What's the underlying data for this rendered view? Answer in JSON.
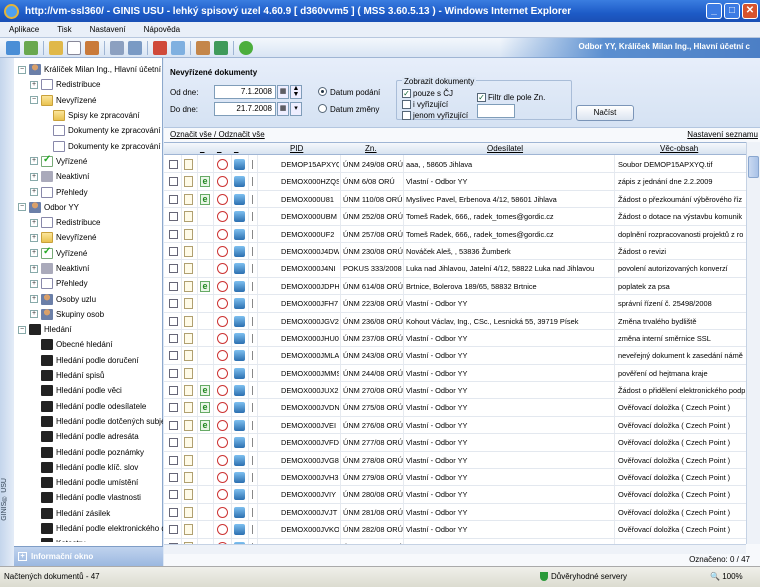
{
  "window": {
    "title": "http://vm-ssl360/ - GINIS USU - lehký spisový uzel 4.60.9 [ d360vvm5 ] ( MSS 3.60.5.13 ) - Windows Internet Explorer"
  },
  "menu": [
    "Aplikace",
    "Tisk",
    "Nastavení",
    "Nápověda"
  ],
  "user": "Odbor YY, Králíček Milan Ing., Hlavní účetní c",
  "tree": [
    {
      "label": "Králíček Milan Ing., Hlavní účetní c",
      "level": 0,
      "pm": "−",
      "icon": "user"
    },
    {
      "label": "Redistribuce",
      "level": 1,
      "pm": "+",
      "icon": "doc"
    },
    {
      "label": "Nevyřízené",
      "level": 1,
      "pm": "−",
      "icon": "folder"
    },
    {
      "label": "Spisy ke zpracování",
      "level": 2,
      "pm": "",
      "icon": "folder"
    },
    {
      "label": "Dokumenty ke zpracování",
      "level": 2,
      "pm": "",
      "icon": "doc"
    },
    {
      "label": "Dokumenty ke zpracování",
      "level": 2,
      "pm": "",
      "icon": "doc"
    },
    {
      "label": "Vyřízené",
      "level": 1,
      "pm": "+",
      "icon": "check"
    },
    {
      "label": "Neaktivní",
      "level": 1,
      "pm": "+",
      "icon": "grey"
    },
    {
      "label": "Přehledy",
      "level": 1,
      "pm": "+",
      "icon": "doc"
    },
    {
      "label": "Odbor YY",
      "level": 0,
      "pm": "−",
      "icon": "user"
    },
    {
      "label": "Redistribuce",
      "level": 1,
      "pm": "+",
      "icon": "doc"
    },
    {
      "label": "Nevyřízené",
      "level": 1,
      "pm": "+",
      "icon": "folder"
    },
    {
      "label": "Vyřízené",
      "level": 1,
      "pm": "+",
      "icon": "check"
    },
    {
      "label": "Neaktivní",
      "level": 1,
      "pm": "+",
      "icon": "grey"
    },
    {
      "label": "Přehledy",
      "level": 1,
      "pm": "+",
      "icon": "doc"
    },
    {
      "label": "Osoby uzlu",
      "level": 1,
      "pm": "+",
      "icon": "user"
    },
    {
      "label": "Skupiny osob",
      "level": 1,
      "pm": "+",
      "icon": "user"
    },
    {
      "label": "Hledání",
      "level": 0,
      "pm": "−",
      "icon": "bino"
    },
    {
      "label": "Obecné hledání",
      "level": 1,
      "pm": "",
      "icon": "bino"
    },
    {
      "label": "Hledání podle doručení",
      "level": 1,
      "pm": "",
      "icon": "bino"
    },
    {
      "label": "Hledání spisů",
      "level": 1,
      "pm": "",
      "icon": "bino"
    },
    {
      "label": "Hledání podle věci",
      "level": 1,
      "pm": "",
      "icon": "bino"
    },
    {
      "label": "Hledání podle odesílatele",
      "level": 1,
      "pm": "",
      "icon": "bino"
    },
    {
      "label": "Hledání podle dotčených subjek",
      "level": 1,
      "pm": "",
      "icon": "bino"
    },
    {
      "label": "Hledání podle adresáta",
      "level": 1,
      "pm": "",
      "icon": "bino"
    },
    {
      "label": "Hledání podle poznámky",
      "level": 1,
      "pm": "",
      "icon": "bino"
    },
    {
      "label": "Hledání podle klíč. slov",
      "level": 1,
      "pm": "",
      "icon": "bino"
    },
    {
      "label": "Hledání podle umístění",
      "level": 1,
      "pm": "",
      "icon": "bino"
    },
    {
      "label": "Hledání podle vlastnosti",
      "level": 1,
      "pm": "",
      "icon": "bino"
    },
    {
      "label": "Hledání zásilek",
      "level": 1,
      "pm": "",
      "icon": "bino"
    },
    {
      "label": "Hledání podle elektronického do",
      "level": 1,
      "pm": "",
      "icon": "bino"
    },
    {
      "label": "Katastry",
      "level": 1,
      "pm": "",
      "icon": "bino"
    }
  ],
  "side_vertical": "GINIS® USU",
  "infobar": "Informační okno",
  "filter": {
    "title": "Nevyřízené dokumenty",
    "od_label": "Od dne:",
    "od_value": "7.1.2008",
    "do_label": "Do dne:",
    "do_value": "21.7.2008",
    "radio1": "Datum podání",
    "radio2": "Datum změny",
    "group": "Zobrazit dokumenty",
    "cb1": "pouze s ČJ",
    "cb2": "i vyřizující",
    "cb3": "jenom vyřizující",
    "cb4": "Filtr dle pole Zn.",
    "load": "Načíst"
  },
  "links": {
    "select": "Označit vše / Odznačit vše",
    "settings": "Nastavení seznamu"
  },
  "columns": {
    "pid": "PID",
    "zn": "Zn.",
    "odesilatel": "Odesílatel",
    "vec": "Věc-obsah"
  },
  "rows": [
    {
      "pid": "DEMOP15APXYQ",
      "zn": "ÚNM 249/08 ORÚ",
      "ode": "aaa, , 58605 Jihlava",
      "vec": "Soubor DEMOP15APXYQ.tif",
      "e": false
    },
    {
      "pid": "DEMOX000HZQS",
      "zn": "ÚNM 6/08 ORÚ",
      "ode": "Vlastní - Odbor YY",
      "vec": "zápis z jednání dne 2.2.2009",
      "e": true
    },
    {
      "pid": "DEMOX000U81",
      "zn": "ÚNM 110/08 ORÚ",
      "ode": "Myslivec Pavel, Erbenova 4/12, 58601 Jihlava",
      "vec": "Žádost o přezkoumání výběrového říz",
      "e": true
    },
    {
      "pid": "DEMOX000UBM",
      "zn": "ÚNM 252/08 ORÚ",
      "ode": "Tomeš Radek, 666,, radek_tomes@gordic.cz",
      "vec": "Žádost o dotace na výstavbu komunik",
      "e": false
    },
    {
      "pid": "DEMOX000UF2",
      "zn": "ÚNM 257/08 ORÚ",
      "ode": "Tomeš Radek, 666,, radek_tomes@gordic.cz",
      "vec": "doplnění rozpracovanosti projektů z ro",
      "e": false
    },
    {
      "pid": "DEMOX000J4DW",
      "zn": "ÚNM 230/08 ORÚ",
      "ode": "Nováček Aleš, , 53836 Žumberk",
      "vec": "Žádost o revizi",
      "e": false
    },
    {
      "pid": "DEMOX000J4NI",
      "zn": "POKUS 333/2008",
      "ode": "Luka nad Jihlavou, Jatelní 4/12, 58822 Luka nad Jihlavou",
      "vec": "povolení autorizovaných konverzí",
      "e": false
    },
    {
      "pid": "DEMOX000JDPH",
      "zn": "ÚNM 614/08 ORÚ",
      "ode": "Brtnice, Bolerova 189/65, 58832 Brtnice",
      "vec": "poplatek za psa",
      "e": true
    },
    {
      "pid": "DEMOX000JFH7",
      "zn": "ÚNM 223/08 ORÚ",
      "ode": "Vlastní - Odbor YY",
      "vec": "správní řízení č. 25498/2008",
      "e": false
    },
    {
      "pid": "DEMOX000JGV2",
      "zn": "ÚNM 236/08 ORÚ",
      "ode": "Kohout Václav, Ing., CSc., Lesnická 55, 39719 Písek",
      "vec": "Změna trvalého bydliště",
      "e": false
    },
    {
      "pid": "DEMOX000JHU0",
      "zn": "ÚNM 237/08 ORÚ",
      "ode": "Vlastní - Odbor YY",
      "vec": "změna interní směrnice SSL",
      "e": false
    },
    {
      "pid": "DEMOX000JMLA",
      "zn": "ÚNM 243/08 ORÚ",
      "ode": "Vlastní - Odbor YY",
      "vec": "neveřejný dokument k zasedání námě",
      "e": false
    },
    {
      "pid": "DEMOX000JMMS",
      "zn": "ÚNM 244/08 ORÚ",
      "ode": "Vlastní - Odbor YY",
      "vec": "pověření od hejtmana kraje",
      "e": false
    },
    {
      "pid": "DEMOX000JUX2",
      "zn": "ÚNM 270/08 ORÚ",
      "ode": "Vlastní - Odbor YY",
      "vec": "Žádost o přidělení elektronického podp",
      "e": true
    },
    {
      "pid": "DEMOX000JVDN",
      "zn": "ÚNM 275/08 ORÚ",
      "ode": "Vlastní - Odbor YY",
      "vec": "Ověřovací doložka ( Czech Point )",
      "e": true
    },
    {
      "pid": "DEMOX000JVEI",
      "zn": "ÚNM 276/08 ORÚ",
      "ode": "Vlastní - Odbor YY",
      "vec": "Ověřovací doložka ( Czech Point )",
      "e": true
    },
    {
      "pid": "DEMOX000JVFD",
      "zn": "ÚNM 277/08 ORÚ",
      "ode": "Vlastní - Odbor YY",
      "vec": "Ověřovací doložka ( Czech Point )",
      "e": false
    },
    {
      "pid": "DEMOX000JVG8",
      "zn": "ÚNM 278/08 ORÚ",
      "ode": "Vlastní - Odbor YY",
      "vec": "Ověřovací doložka ( Czech Point )",
      "e": false
    },
    {
      "pid": "DEMOX000JVH3",
      "zn": "ÚNM 279/08 ORÚ",
      "ode": "Vlastní - Odbor YY",
      "vec": "Ověřovací doložka ( Czech Point )",
      "e": false
    },
    {
      "pid": "DEMOX000JVIY",
      "zn": "ÚNM 280/08 ORÚ",
      "ode": "Vlastní - Odbor YY",
      "vec": "Ověřovací doložka ( Czech Point )",
      "e": false
    },
    {
      "pid": "DEMOX000JVJT",
      "zn": "ÚNM 281/08 ORÚ",
      "ode": "Vlastní - Odbor YY",
      "vec": "Ověřovací doložka ( Czech Point )",
      "e": false
    },
    {
      "pid": "DEMOX000JVKO",
      "zn": "ÚNM 282/08 ORÚ",
      "ode": "Vlastní - Odbor YY",
      "vec": "Ověřovací doložka ( Czech Point )",
      "e": false
    },
    {
      "pid": "DEMOX000JVLJ",
      "zn": "ÚNM 283/08 ORÚ",
      "ode": "Vlastní - Odbor YY",
      "vec": "Ověřovací doložka ( Czech Point )",
      "e": false
    }
  ],
  "marked": "Označeno: 0 / 47",
  "status": {
    "left": "Načtených dokumentů - 47",
    "zone": "Důvěryhodné servery",
    "zoom": "100%"
  }
}
